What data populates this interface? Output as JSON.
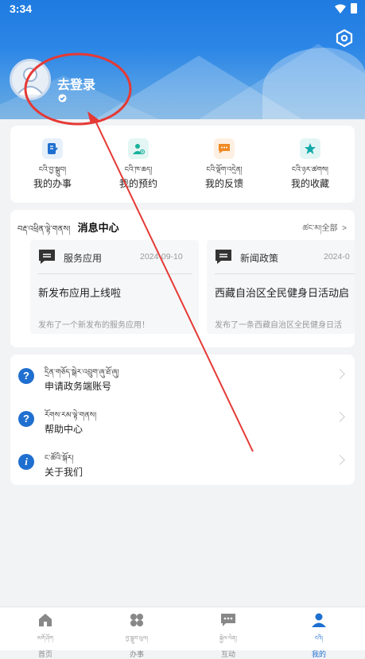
{
  "status_bar": {
    "time": "3:34"
  },
  "profile": {
    "login_label": "去登录"
  },
  "quick_actions": [
    {
      "tibetan": "ངའི་བྱ་སྒྲུབ།",
      "label": "我的办事",
      "icon": "document-edit-icon",
      "color": "#1f6fd0",
      "bg": "#e6f0fb"
    },
    {
      "tibetan": "ངའི་ཁ་ཆད།",
      "label": "我的预约",
      "icon": "person-add-icon",
      "color": "#19b19c",
      "bg": "#e3f6f3"
    },
    {
      "tibetan": "ངའི་ལྡོག་འདྲེན།",
      "label": "我的反馈",
      "icon": "chat-bubble-icon",
      "color": "#f08a24",
      "bg": "#fdf0e3"
    },
    {
      "tibetan": "ངའི་ཉར་ཚགས།",
      "label": "我的收藏",
      "icon": "star-icon",
      "color": "#12a9a9",
      "bg": "#e2f5f5"
    }
  ],
  "message_center": {
    "tibetan": "བརྡ་འཕྲིན་ལྟེ་གནས།",
    "title": "消息中心",
    "all_tibetan": "ཚང་མ།",
    "all_label": "全部",
    "cards": [
      {
        "category": "服务应用",
        "date": "2024-09-10",
        "title": "新发布应用上线啦",
        "desc": "发布了一个新发布的服务应用！"
      },
      {
        "category": "新闻政策",
        "date": "2024-0",
        "title": "西藏自治区全民健身日活动启",
        "desc": "发布了一条西藏自治区全民健身日活"
      }
    ]
  },
  "links": [
    {
      "tibetan": "དྲིན་གཅོད་སྒེར་འབྲུག་ཞུ་ཐོ་ཞུ།",
      "label": "申请政务端账号"
    },
    {
      "tibetan": "རོགས་རམ་ལྟེ་གནས།",
      "label": "帮助中心"
    },
    {
      "tibetan": "ང་ཚོའི་སྐོར།",
      "label": "关于我们"
    }
  ],
  "tabs": [
    {
      "tibetan": "མགོ་ཤོག",
      "label": "首页",
      "active": false
    },
    {
      "tibetan": "བྱ་སྒྲུབ་ཡུལ།",
      "label": "办事",
      "active": false
    },
    {
      "tibetan": "སྐྱེལ་ལེན།",
      "label": "互动",
      "active": false
    },
    {
      "tibetan": "ངའི།",
      "label": "我的",
      "active": true
    }
  ],
  "colors": {
    "primary": "#1f6fd0",
    "annotation_red": "#e53935"
  }
}
